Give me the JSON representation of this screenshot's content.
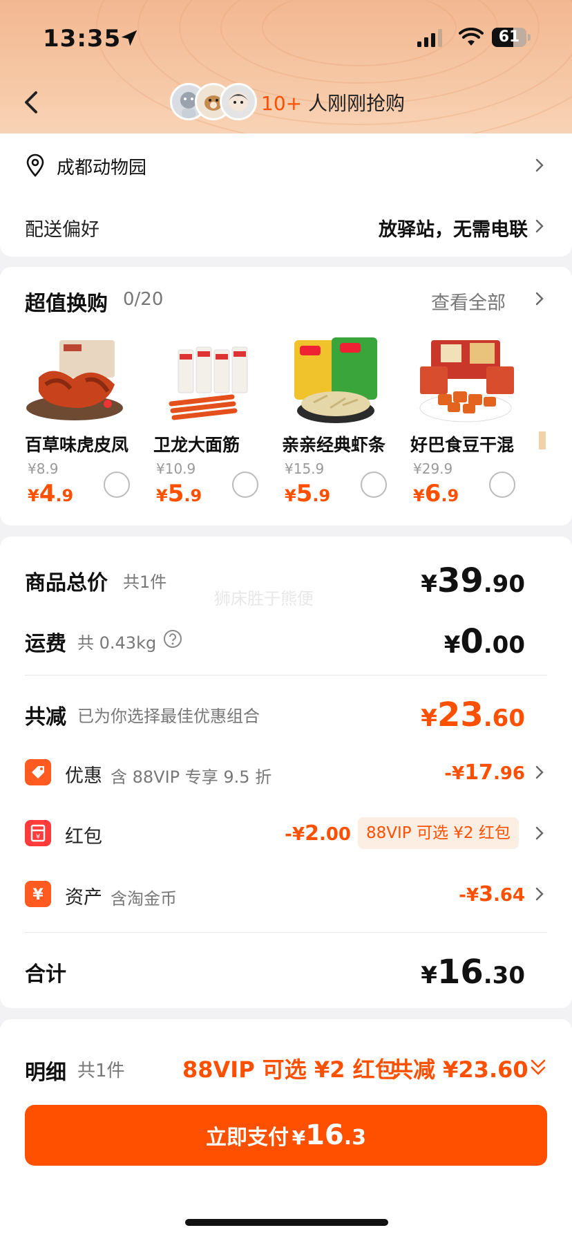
{
  "status_bar": {
    "time": "13:35",
    "battery": "61"
  },
  "header": {
    "count": "10+",
    "text": " 人刚刚抢购"
  },
  "address": {
    "location": "成都动物园",
    "pref_label": "配送偏好",
    "pref_value": "放驿站，无需电联"
  },
  "deals": {
    "title": "超值换购",
    "count": "0/20",
    "see_all": "查看全部",
    "items": [
      {
        "name": "百草味虎皮凤",
        "orig": "¥8.9",
        "yen": "¥",
        "int": "4",
        "dec": ".9"
      },
      {
        "name": "卫龙大面筋",
        "orig": "¥10.9",
        "yen": "¥",
        "int": "5",
        "dec": ".9"
      },
      {
        "name": "亲亲经典虾条",
        "orig": "¥15.9",
        "yen": "¥",
        "int": "5",
        "dec": ".9"
      },
      {
        "name": "好巴食豆干混",
        "orig": "¥29.9",
        "yen": "¥",
        "int": "6",
        "dec": ".9"
      }
    ]
  },
  "summary": {
    "goods": {
      "label": "商品总价",
      "sub": "共1件",
      "yen": "¥",
      "int": "39",
      "dec": ".90"
    },
    "shipping": {
      "label": "运费",
      "sub": "共 0.43kg",
      "yen": "¥",
      "int": "0",
      "dec": ".00"
    },
    "reduce": {
      "label": "共减",
      "sub": "已为你选择最佳优惠组合",
      "yen": "¥",
      "int": "23",
      "dec": ".60"
    },
    "discount": {
      "label": "优惠",
      "sub": "含 88VIP 专享 9.5 折",
      "yen": "-¥",
      "int": "17",
      "dec": ".96"
    },
    "redpacket": {
      "label": "红包",
      "yen": "-¥",
      "int": "2",
      "dec": ".00",
      "tag": "88VIP 可选 ¥2 红包"
    },
    "assets": {
      "label": "资产",
      "sub": "含淘金币",
      "yen": "-¥",
      "int": "3",
      "dec": ".64"
    },
    "total": {
      "label": "合计",
      "yen": "¥",
      "int": "16",
      "dec": ".30"
    }
  },
  "watermark": "狮床胜于熊便",
  "bottom": {
    "detail_label": "明细",
    "detail_count": "共1件",
    "promo": "88VIP 可选 ¥2 红包",
    "total_reduce": "共减 ¥23.60",
    "pay_label": "立即支付",
    "pay_yen": "¥",
    "pay_int": "16",
    "pay_dec": ".3"
  },
  "colors": {
    "accent": "#ff5000",
    "header_bg": "#f6c7a4"
  }
}
